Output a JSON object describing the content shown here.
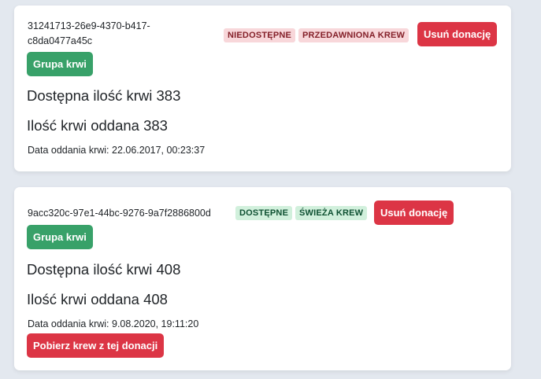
{
  "donations": [
    {
      "id": "31241713-26e9-4370-b417-c8da0477a45c",
      "availability_badge": "NIEDOSTĘPNE",
      "freshness_badge": "PRZEDAWNIONA KREW",
      "delete_label": "Usuń donację",
      "blood_group_label": "Grupa krwi",
      "available_text": "Dostępna ilość krwi 383",
      "donated_text": "Ilość krwi oddana 383",
      "date_text": "Data oddania krwi: 22.06.2017, 00:23:37"
    },
    {
      "id": "9acc320c-97e1-44bc-9276-9a7f2886800d",
      "availability_badge": "DOSTĘPNE",
      "freshness_badge": "ŚWIEŻA KREW",
      "delete_label": "Usuń donację",
      "blood_group_label": "Grupa krwi",
      "available_text": "Dostępna ilość krwi 408",
      "donated_text": "Ilość krwi oddana 408",
      "date_text": "Data oddania krwi: 9.08.2020, 19:11:20",
      "take_blood_label": "Pobierz krew z tej donacji"
    }
  ],
  "colors": {
    "danger": "#dc3545",
    "success": "#38a169",
    "badge_red_bg": "#f8d7da",
    "badge_green_bg": "#d1f0dc",
    "page_bg": "#e3e8ef"
  }
}
